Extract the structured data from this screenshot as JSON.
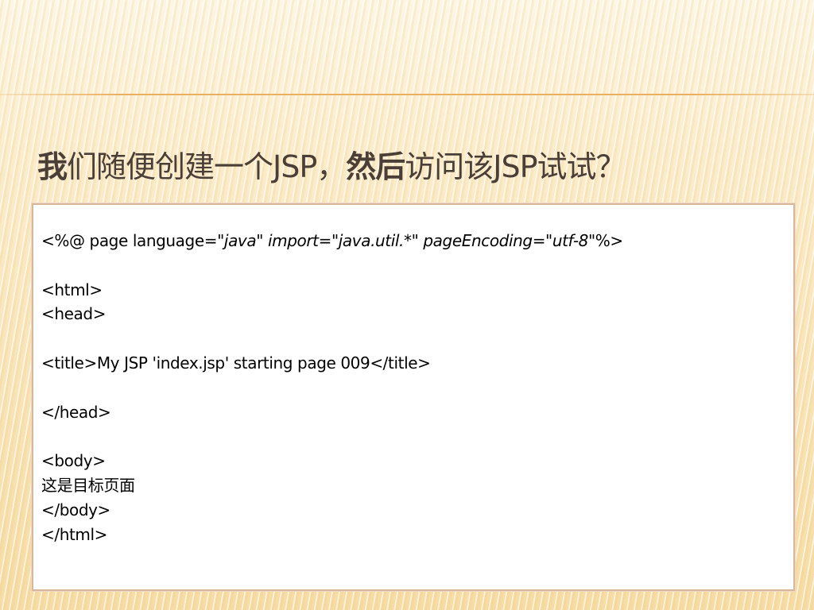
{
  "slide": {
    "title_part1_bold": "我",
    "title_part2": "们随便创建一个JSP，",
    "title_part3_bold": "然后",
    "title_part4": "访问该JSP试试？"
  },
  "code": {
    "line1": {
      "a": "<%@ page language=",
      "b": "\"java\" import=\"java.util.*\" pageEncoding=\"utf-8\"",
      "c": "%>"
    },
    "line2": "",
    "line3": "<html>",
    "line4": "<head>",
    "line5": "",
    "line6": "<title>My JSP 'index.jsp' starting page 009</title>",
    "line7": "",
    "line8": "</head>",
    "line9": "",
    "line10": "<body>",
    "line11": "这是目标页面",
    "line12": "</body>",
    "line13": "</html>"
  }
}
